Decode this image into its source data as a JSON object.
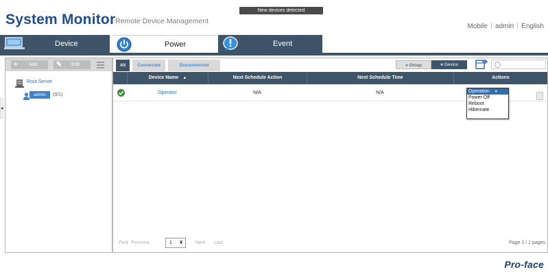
{
  "header": {
    "title": "System Monitor",
    "subtitle": "Remote Device Management",
    "notification": "New devices detected",
    "links": [
      "Mobile",
      "admin",
      "English"
    ]
  },
  "nav": {
    "device": "Device",
    "power": "Power",
    "event": "Event"
  },
  "sidebar": {
    "add_label": "Add",
    "edit_label": "Edit",
    "root_label": "Root Server",
    "user_label": "admin",
    "user_count": "(0/1)"
  },
  "subtabs": {
    "all": "All",
    "connected": "Connected",
    "disconnected": "Disconnected"
  },
  "view_toggle": {
    "group": "Group",
    "device": "Device"
  },
  "table": {
    "headers": {
      "name": "Device Name",
      "next_action": "Next Schedule Action",
      "next_time": "Next Schedule Time",
      "actions": "Actions"
    },
    "rows": [
      {
        "name": "Operator",
        "next_action": "N/A",
        "next_time": "N/A"
      }
    ]
  },
  "actions_dropdown": {
    "selected": "Operation",
    "options": [
      "Power Off",
      "Reboot",
      "Hibernate"
    ]
  },
  "pager": {
    "first": "First",
    "previous": "Previous",
    "page": "1",
    "next": "Next",
    "last": "Last",
    "info": "Page 1 / 1 pages"
  },
  "brand": "Pro-face",
  "colors": {
    "nav_dark": "#3e5468",
    "title_blue": "#1f4e8a",
    "link_blue": "#2f6db3",
    "ok_green": "#3d8a3d"
  }
}
